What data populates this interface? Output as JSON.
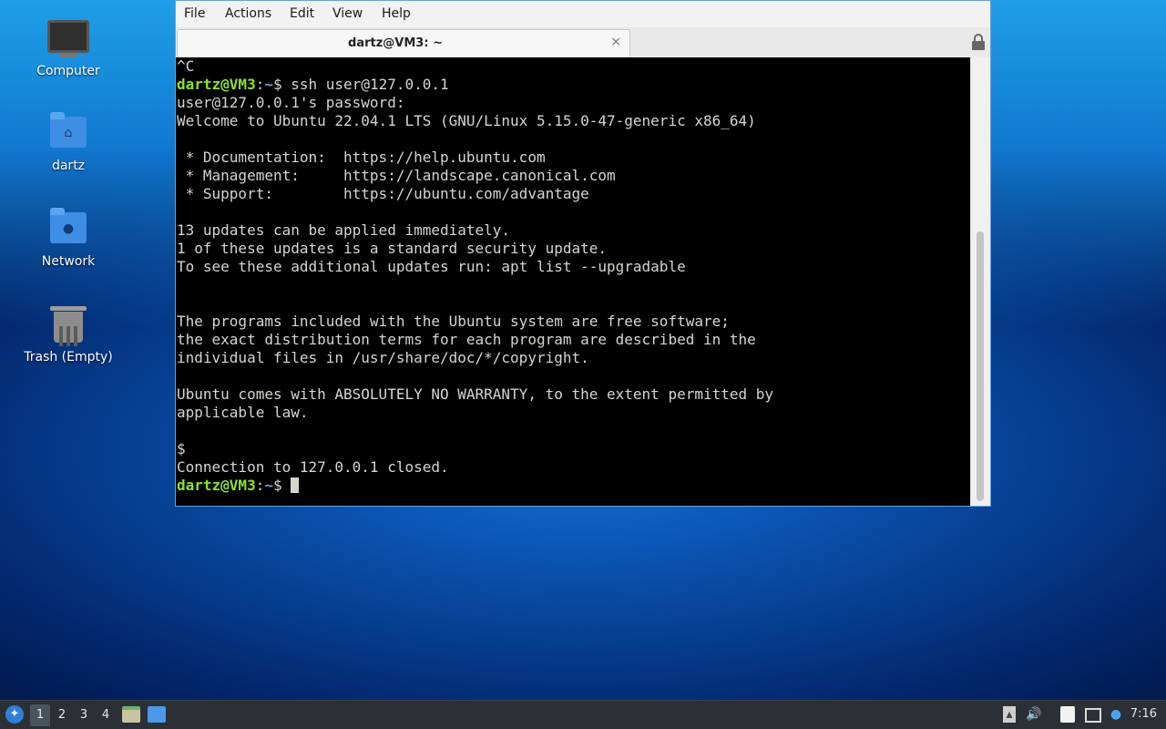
{
  "desktop": {
    "icons": [
      {
        "label": "Computer",
        "icon": "computer-icon"
      },
      {
        "label": "dartz",
        "icon": "home-folder-icon"
      },
      {
        "label": "Network",
        "icon": "network-folder-icon"
      },
      {
        "label": "Trash (Empty)",
        "icon": "trash-icon"
      }
    ]
  },
  "window": {
    "menu": [
      "File",
      "Actions",
      "Edit",
      "View",
      "Help"
    ],
    "tab_title": "dartz@VM3: ~",
    "tab_close": "×"
  },
  "terminal": {
    "prompt_user": "dartz@VM3",
    "prompt_sep": ":",
    "prompt_path": "~",
    "prompt_end": "$ ",
    "lines": [
      "^C",
      "ssh user@127.0.0.1",
      "user@127.0.0.1's password:",
      "Welcome to Ubuntu 22.04.1 LTS (GNU/Linux 5.15.0-47-generic x86_64)",
      "",
      " * Documentation:  https://help.ubuntu.com",
      " * Management:     https://landscape.canonical.com",
      " * Support:        https://ubuntu.com/advantage",
      "",
      "13 updates can be applied immediately.",
      "1 of these updates is a standard security update.",
      "To see these additional updates run: apt list --upgradable",
      "",
      "",
      "The programs included with the Ubuntu system are free software;",
      "the exact distribution terms for each program are described in the",
      "individual files in /usr/share/doc/*/copyright.",
      "",
      "Ubuntu comes with ABSOLUTELY NO WARRANTY, to the extent permitted by",
      "applicable law.",
      "",
      "$",
      "Connection to 127.0.0.1 closed."
    ]
  },
  "taskbar": {
    "workspaces": [
      "1",
      "2",
      "3",
      "4"
    ],
    "active_workspace": "1",
    "clock": "7:16"
  }
}
